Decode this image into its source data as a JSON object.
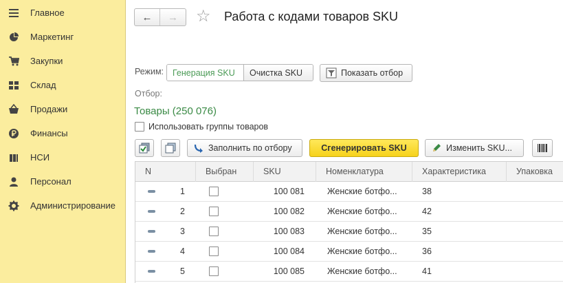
{
  "sidebar": {
    "items": [
      {
        "label": "Главное",
        "icon": "menu-lines-icon"
      },
      {
        "label": "Маркетинг",
        "icon": "pie-chart-icon"
      },
      {
        "label": "Закупки",
        "icon": "cart-icon"
      },
      {
        "label": "Склад",
        "icon": "grid-icon"
      },
      {
        "label": "Продажи",
        "icon": "basket-icon"
      },
      {
        "label": "Финансы",
        "icon": "ruble-coin-icon"
      },
      {
        "label": "НСИ",
        "icon": "books-icon"
      },
      {
        "label": "Персонал",
        "icon": "person-icon"
      },
      {
        "label": "Администрирование",
        "icon": "gear-icon"
      }
    ]
  },
  "header": {
    "back": "←",
    "forward": "→",
    "star": "☆",
    "title": "Работа с кодами товаров SKU"
  },
  "mode": {
    "label": "Режим:",
    "options": [
      "Генерация SKU",
      "Очистка SKU"
    ],
    "selected": "Генерация SKU",
    "show_filter_label": "Показать отбор"
  },
  "filter": {
    "label": "Отбор:",
    "goods_link": "Товары (250 076)",
    "use_groups_label": "Использовать группы товаров",
    "use_groups_checked": false
  },
  "toolbar": {
    "fill_label": "Заполнить по отбору",
    "generate_label": "Сгенерировать SKU",
    "edit_label": "Изменить SKU..."
  },
  "table": {
    "columns": [
      "N",
      "Выбран",
      "SKU",
      "Номенклатура",
      "Характеристика",
      "Упаковка"
    ],
    "rows": [
      {
        "n": "1",
        "selected": false,
        "sku": "100 081",
        "item": "Женские ботфо...",
        "characteristic": "38",
        "pack": ""
      },
      {
        "n": "2",
        "selected": false,
        "sku": "100 082",
        "item": "Женские ботфо...",
        "characteristic": "42",
        "pack": ""
      },
      {
        "n": "3",
        "selected": false,
        "sku": "100 083",
        "item": "Женские ботфо...",
        "characteristic": "35",
        "pack": ""
      },
      {
        "n": "4",
        "selected": false,
        "sku": "100 084",
        "item": "Женские ботфо...",
        "characteristic": "36",
        "pack": ""
      },
      {
        "n": "5",
        "selected": false,
        "sku": "100 085",
        "item": "Женские ботфо...",
        "characteristic": "41",
        "pack": ""
      }
    ]
  }
}
